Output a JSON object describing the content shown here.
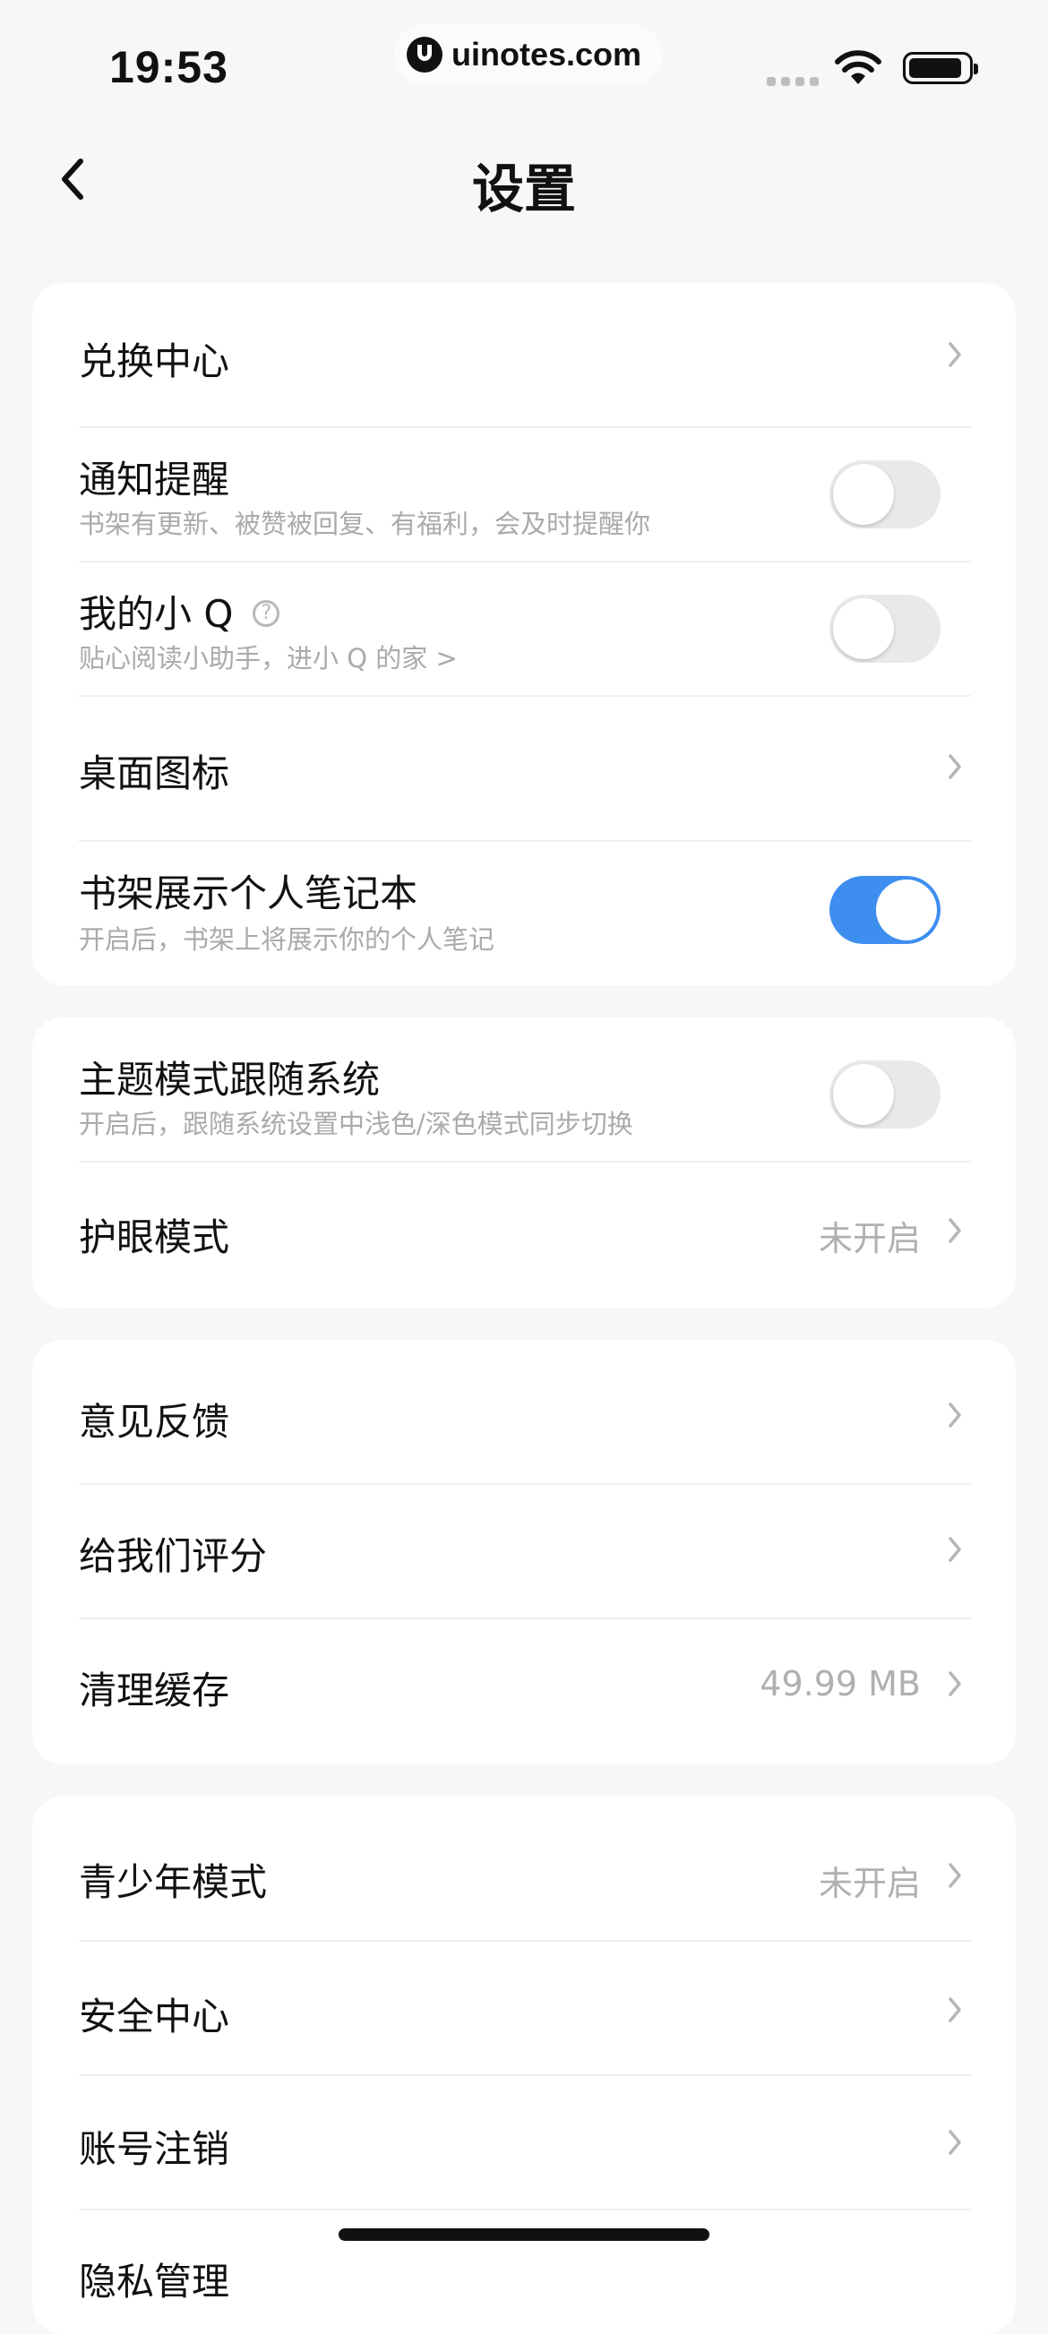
{
  "status_bar": {
    "time": "19:53",
    "watermark": "uinotes.com"
  },
  "nav": {
    "title": "设置"
  },
  "sections": {
    "s1": {
      "redeem": {
        "label": "兑换中心"
      },
      "notify": {
        "label": "通知提醒",
        "sub": "书架有更新、被赞被回复、有福利，会及时提醒你",
        "on": false
      },
      "little_q": {
        "label": "我的小 Q",
        "help": "?",
        "sub": "贴心阅读小助手，进小 Q 的家 >",
        "on": false
      },
      "desktop_icon": {
        "label": "桌面图标"
      },
      "shelf_notes": {
        "label": "书架展示个人笔记本",
        "sub": "开启后，书架上将展示你的个人笔记",
        "on": true
      }
    },
    "s2": {
      "theme_follow": {
        "label": "主题模式跟随系统",
        "sub": "开启后，跟随系统设置中浅色/深色模式同步切换",
        "on": false
      },
      "eye_care": {
        "label": "护眼模式",
        "value": "未开启"
      }
    },
    "s3": {
      "feedback": {
        "label": "意见反馈"
      },
      "rate_us": {
        "label": "给我们评分"
      },
      "clear_cache": {
        "label": "清理缓存",
        "value": "49.99 MB"
      }
    },
    "s4": {
      "teen_mode": {
        "label": "青少年模式",
        "value": "未开启"
      },
      "security": {
        "label": "安全中心"
      },
      "account_cancel": {
        "label": "账号注销"
      },
      "privacy": {
        "label": "隐私管理"
      }
    }
  },
  "colors": {
    "toggle_on": "#3e8ef0",
    "toggle_off": "#e9e9e9",
    "background": "#f7f7f7"
  }
}
